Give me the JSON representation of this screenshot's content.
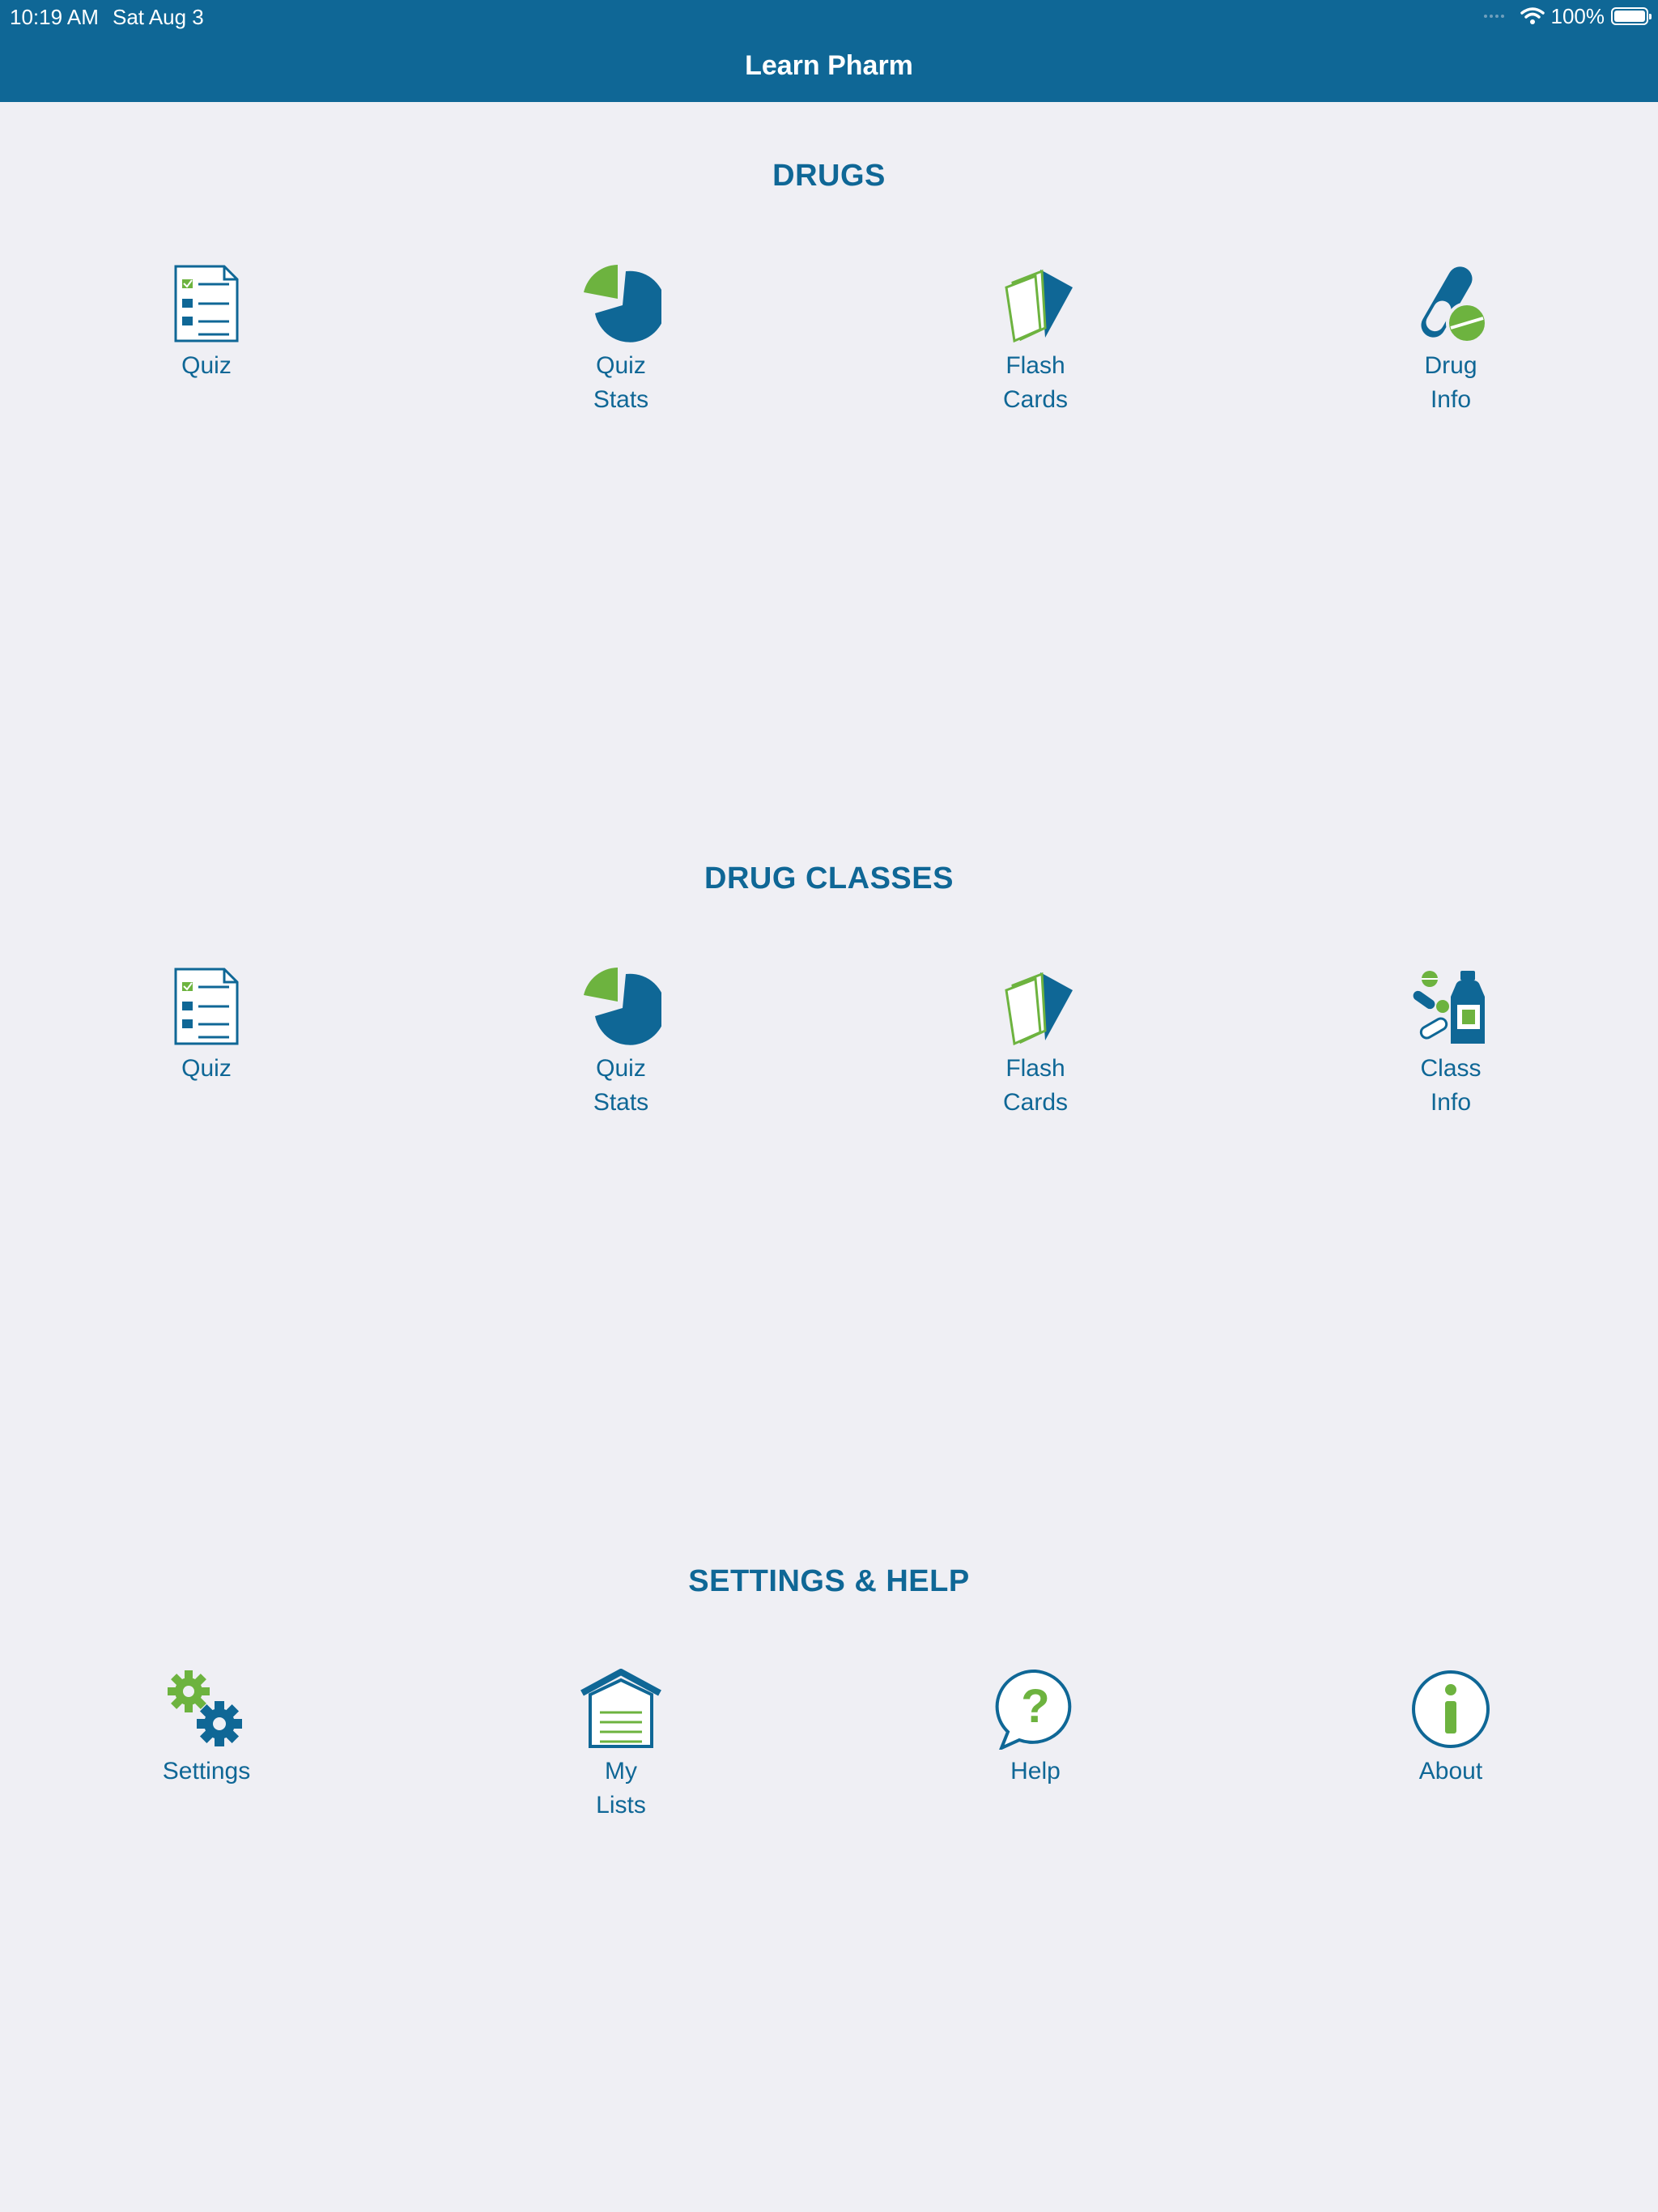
{
  "status_bar": {
    "time": "10:19 AM",
    "date": "Sat Aug 3",
    "battery": "100%",
    "icons": [
      "signal-dots-icon",
      "wifi-icon",
      "battery-icon"
    ]
  },
  "header": {
    "title": "Learn Pharm"
  },
  "colors": {
    "brand_blue": "#0f6796",
    "accent_green": "#6db33f",
    "background": "#efeff4"
  },
  "sections": [
    {
      "title": "DRUGS",
      "items": [
        {
          "label": "Quiz",
          "icon": "quiz-checklist-icon"
        },
        {
          "label": "Quiz\nStats",
          "icon": "pie-chart-icon"
        },
        {
          "label": "Flash\nCards",
          "icon": "flash-cards-icon"
        },
        {
          "label": "Drug\nInfo",
          "icon": "pill-capsule-icon"
        }
      ]
    },
    {
      "title": "DRUG CLASSES",
      "items": [
        {
          "label": "Quiz",
          "icon": "quiz-checklist-icon"
        },
        {
          "label": "Quiz\nStats",
          "icon": "pie-chart-icon"
        },
        {
          "label": "Flash\nCards",
          "icon": "flash-cards-icon"
        },
        {
          "label": "Class\nInfo",
          "icon": "medicine-bottle-icon"
        }
      ]
    },
    {
      "title": "SETTINGS & HELP",
      "items": [
        {
          "label": "Settings",
          "icon": "gears-icon"
        },
        {
          "label": "My\nLists",
          "icon": "house-list-icon"
        },
        {
          "label": "Help",
          "icon": "question-bubble-icon"
        },
        {
          "label": "About",
          "icon": "info-circle-icon"
        }
      ]
    }
  ]
}
